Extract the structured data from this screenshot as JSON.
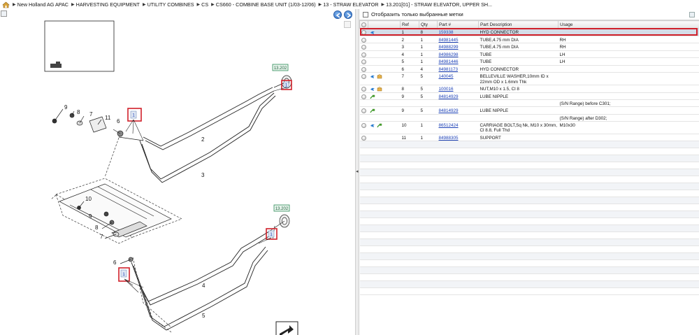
{
  "breadcrumb": [
    "New Holland AG APAC",
    "HARVESTING EQUIPMENT",
    "UTILITY COMBINES",
    "CS",
    "CS660 - COMBINE BASE UNIT (1/03-12/06)",
    "13 - STRAW ELEVATOR",
    "13.201[01] - STRAW ELEVATOR, UPPER SH..."
  ],
  "icons": {
    "home": "home-icon",
    "nav_prev": "arrow-left-icon",
    "nav_next": "arrow-right-icon",
    "left_toolbar": "zoom-tool-icon",
    "filter_right": "print-icon",
    "tube": "tube-icon",
    "info": "info-icon",
    "package": "package-icon",
    "arrow": "green-arrow-icon"
  },
  "colors": {
    "selection_outline": "#d0202a",
    "callout_outline": "#d0202a",
    "link": "#1a3fb5",
    "ref_tag": "#2e8b57"
  },
  "diagram": {
    "callouts": [
      "9",
      "8",
      "7",
      "11",
      "6",
      "1",
      "2",
      "3",
      "10",
      "9",
      "8",
      "7",
      "6",
      "1",
      "4",
      "5",
      "1"
    ],
    "ref_tags": [
      "13.202",
      "13.202"
    ]
  },
  "filter": {
    "label": "Отобразить только выбранные метки",
    "checked": false
  },
  "table": {
    "headers": [
      "",
      "",
      "Ref",
      "Qty",
      "Part #",
      "Part Description",
      "Usage"
    ],
    "rows": [
      {
        "ref": "1",
        "qty": "8",
        "part": "159338",
        "desc": "HYD CONNECTOR",
        "usage": "",
        "icons": [
          "info"
        ],
        "selected": true
      },
      {
        "ref": "2",
        "qty": "1",
        "part": "84981445",
        "desc": "TUBE,4.75 mm DIA",
        "usage": "RH",
        "icons": []
      },
      {
        "ref": "3",
        "qty": "1",
        "part": "84988299",
        "desc": "TUBE,4.75 mm DIA",
        "usage": "RH",
        "icons": []
      },
      {
        "ref": "4",
        "qty": "1",
        "part": "84986298",
        "desc": "TUBE",
        "usage": "LH",
        "icons": []
      },
      {
        "ref": "5",
        "qty": "1",
        "part": "84981446",
        "desc": "TUBE",
        "usage": "LH",
        "icons": []
      },
      {
        "ref": "6",
        "qty": "4",
        "part": "84981173",
        "desc": "HYD CONNECTOR",
        "usage": "",
        "icons": []
      },
      {
        "ref": "7",
        "qty": "5",
        "part": "140045",
        "desc": "BELLEVILLE WASHER,10mm ID x 22mm OD x 1.6mm Thk",
        "usage": "",
        "icons": [
          "info",
          "package"
        ]
      },
      {
        "ref": "8",
        "qty": "5",
        "part": "100016",
        "desc": "NUT,M10 x 1.5, Cl 8",
        "usage": "",
        "icons": [
          "info",
          "package"
        ]
      },
      {
        "ref": "9",
        "qty": "5",
        "part": "84814929",
        "desc": "LUBE NIPPLE",
        "usage": "",
        "icons": [
          "arrow"
        ]
      },
      {
        "ref": "",
        "qty": "",
        "part": "",
        "desc": "",
        "usage": "(S/N Range) before C301;",
        "icons": [],
        "note": true
      },
      {
        "ref": "9",
        "qty": "5",
        "part": "84814929",
        "desc": "LUBE NIPPLE",
        "usage": "",
        "icons": [
          "arrow"
        ]
      },
      {
        "ref": "",
        "qty": "",
        "part": "",
        "desc": "",
        "usage": "(S/N Range) after D302;",
        "icons": [],
        "note": true
      },
      {
        "ref": "10",
        "qty": "1",
        "part": "86512424",
        "desc": "CARRIAGE BOLT,Sq Nk, M10 x 30mm, Cl 8.8, Full Thd",
        "usage": "M10x30",
        "icons": [
          "info",
          "arrow"
        ]
      },
      {
        "ref": "11",
        "qty": "1",
        "part": "84988305",
        "desc": "SUPPORT",
        "usage": "",
        "icons": []
      }
    ]
  }
}
